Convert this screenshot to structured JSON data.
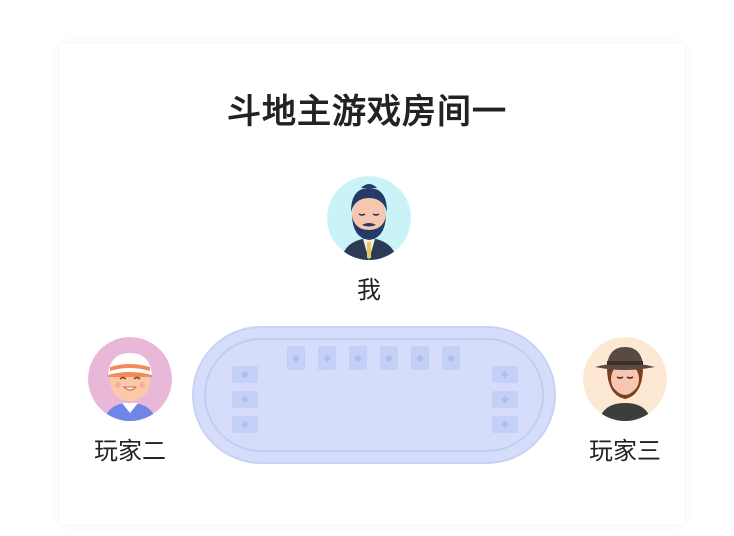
{
  "room": {
    "title": "斗地主游戏房间一"
  },
  "players": {
    "self": {
      "name": "我",
      "avatar_icon": "bearded-man-avatar-icon"
    },
    "left": {
      "name": "玩家二",
      "avatar_icon": "cap-boy-avatar-icon"
    },
    "right": {
      "name": "玩家三",
      "avatar_icon": "hat-man-avatar-icon"
    }
  },
  "table": {
    "color": "#d5ddfa",
    "top_cards": 6,
    "left_cards": 3,
    "right_cards": 3
  },
  "colors": {
    "card_back": "#c5d0f7",
    "self_avatar_bg": "#c9f3f7",
    "left_avatar_bg": "#e9b8d8",
    "right_avatar_bg": "#fde9d3"
  }
}
